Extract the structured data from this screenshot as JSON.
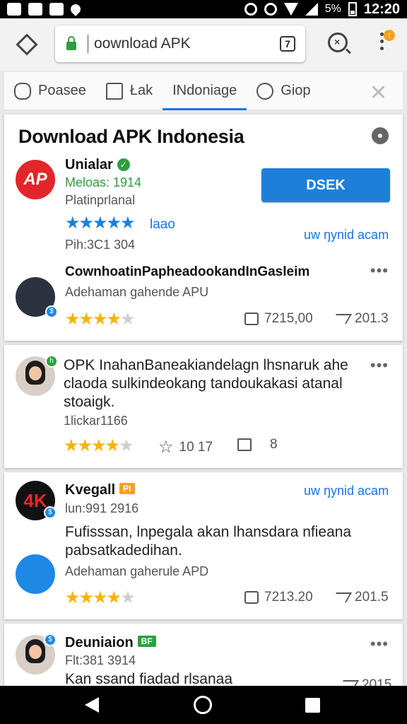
{
  "status": {
    "battery": "5%",
    "time": "12:20"
  },
  "browser": {
    "url": "oownload APK",
    "tab_count": "7"
  },
  "tabs": [
    {
      "label": "Poasee",
      "icon": "puzzle-icon"
    },
    {
      "label": "Łak",
      "icon": "chat-icon"
    },
    {
      "label": "INdoniage",
      "icon": "",
      "active": true
    },
    {
      "label": "Giop",
      "icon": "palette-icon"
    }
  ],
  "page": {
    "title": "Download APK Indonesia"
  },
  "app": {
    "avatar_text": "AP",
    "name": "Unialar",
    "downloads": "Meloas: 1914",
    "platform": "Platinprlanal",
    "rating_text": "laao",
    "pin": "Pih:3C1 304",
    "button": "DSEK",
    "link": "uw ŋynid acam"
  },
  "posts": [
    {
      "title": "CownhoatinPapheadookandInGasleim",
      "subtitle": "Adehaman gahende APU",
      "likes": "7215,00",
      "shares": "201.3"
    },
    {
      "body": "OPK InahanBaneakiandelagn lhsnaruk ahe claoda sulkindeokang tandoukakasi atanal stoaigk.",
      "meta": "1lickar1166",
      "favorites": "10 17",
      "comments": "8"
    },
    {
      "name": "Kvegall",
      "tag": "PI",
      "sub": "lun:991 2916",
      "link": "uw ŋynid acam",
      "body": "Fufisssan, lnpegala akan lhansdara nfieana pabsatkadedihan.",
      "subtitle": "Adehaman gaherule APD",
      "likes": "7213.20",
      "shares": "201.5"
    },
    {
      "name": "Deuniaion",
      "tag": "BF",
      "sub": "Flt:381 3914",
      "body": "Kan ssand fiadad rlsanaa",
      "shares": "2015"
    }
  ]
}
